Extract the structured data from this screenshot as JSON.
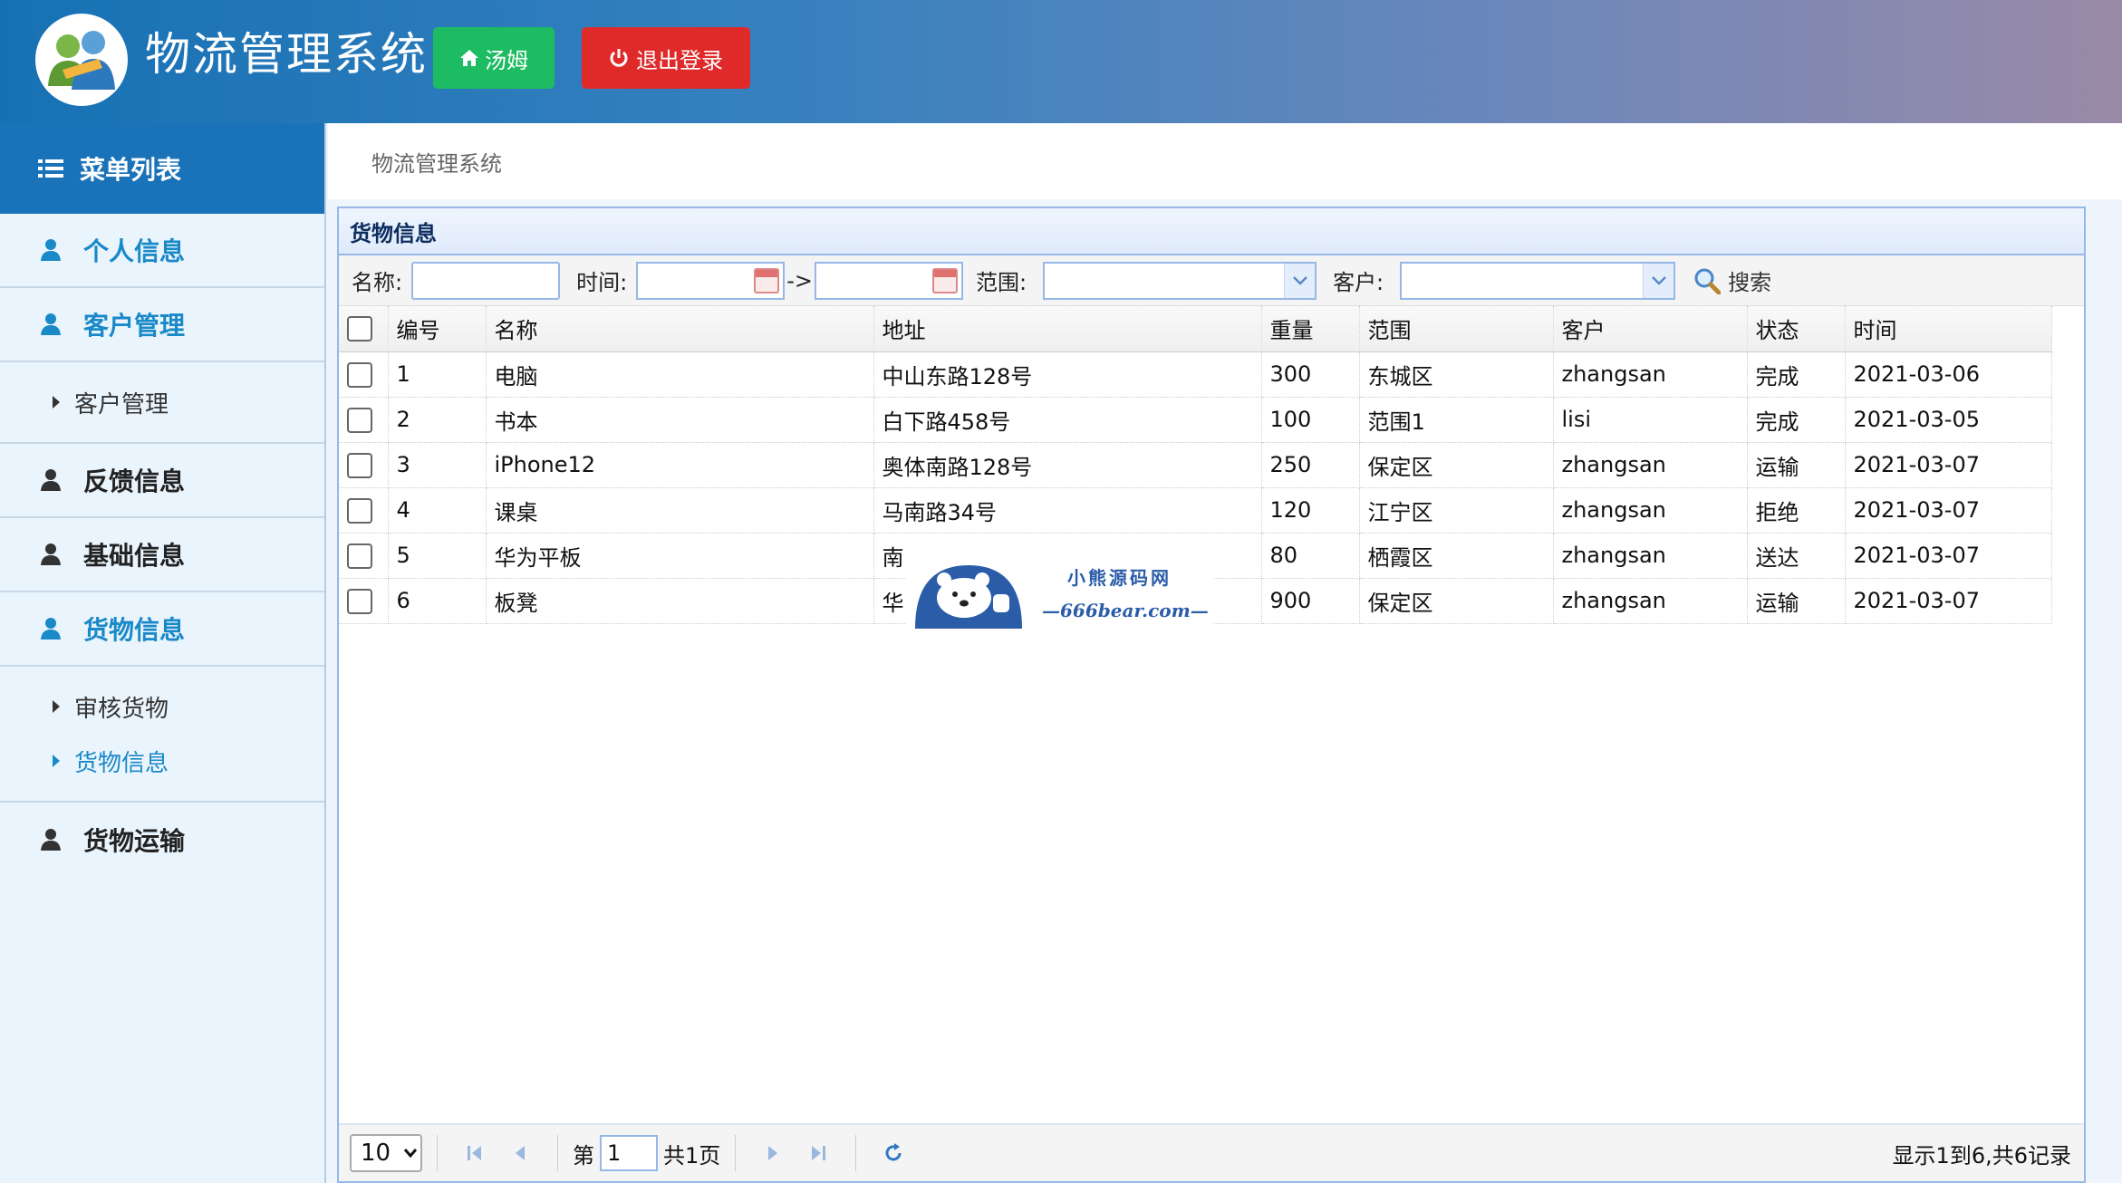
{
  "header": {
    "app_title": "物流管理系统",
    "home_label": "汤姆",
    "logout_label": "退出登录",
    "colors": {
      "home_button": "#1ebc62",
      "logout_button": "#e02a2a"
    }
  },
  "sidebar": {
    "title": "菜单列表",
    "menus": [
      {
        "label": "个人信息",
        "icon": "user-icon"
      },
      {
        "label": "客户管理",
        "icon": "user-icon",
        "sub": [
          "客户管理"
        ]
      },
      {
        "label": "反馈信息",
        "icon": "user-icon"
      },
      {
        "label": "基础信息",
        "icon": "user-icon"
      },
      {
        "label": "货物信息",
        "icon": "user-icon",
        "sub": [
          "审核货物",
          "货物信息"
        ]
      },
      {
        "label": "货物运输",
        "icon": "user-icon"
      }
    ]
  },
  "breadcrumb": "物流管理系统",
  "panel": {
    "title": "货物信息",
    "filters": {
      "name_label": "名称:",
      "time_label": "时间:",
      "arrow": "->",
      "range_label": "范围:",
      "customer_label": "客户:",
      "search_label": "搜索"
    },
    "columns": [
      "编号",
      "名称",
      "地址",
      "重量",
      "范围",
      "客户",
      "状态",
      "时间"
    ],
    "rows": [
      [
        "1",
        "电脑",
        "中山东路128号",
        "300",
        "东城区",
        "zhangsan",
        "完成",
        "2021-03-06"
      ],
      [
        "2",
        "书本",
        "白下路458号",
        "100",
        "范围1",
        "lisi",
        "完成",
        "2021-03-05"
      ],
      [
        "3",
        "iPhone12",
        "奥体南路128号",
        "250",
        "保定区",
        "zhangsan",
        "运输",
        "2021-03-07"
      ],
      [
        "4",
        "课桌",
        "马南路34号",
        "120",
        "江宁区",
        "zhangsan",
        "拒绝",
        "2021-03-07"
      ],
      [
        "5",
        "华为平板",
        "南",
        "80",
        "栖霞区",
        "zhangsan",
        "送达",
        "2021-03-07"
      ],
      [
        "6",
        "板凳",
        "华",
        "900",
        "保定区",
        "zhangsan",
        "运输",
        "2021-03-07"
      ]
    ],
    "pager": {
      "page_size": "10",
      "page_prefix": "第",
      "page_value": "1",
      "page_suffix": "共1页",
      "info": "显示1到6,共6记录"
    }
  },
  "watermark": {
    "line1": "小熊源码网",
    "line2": "—666bear.com—"
  }
}
